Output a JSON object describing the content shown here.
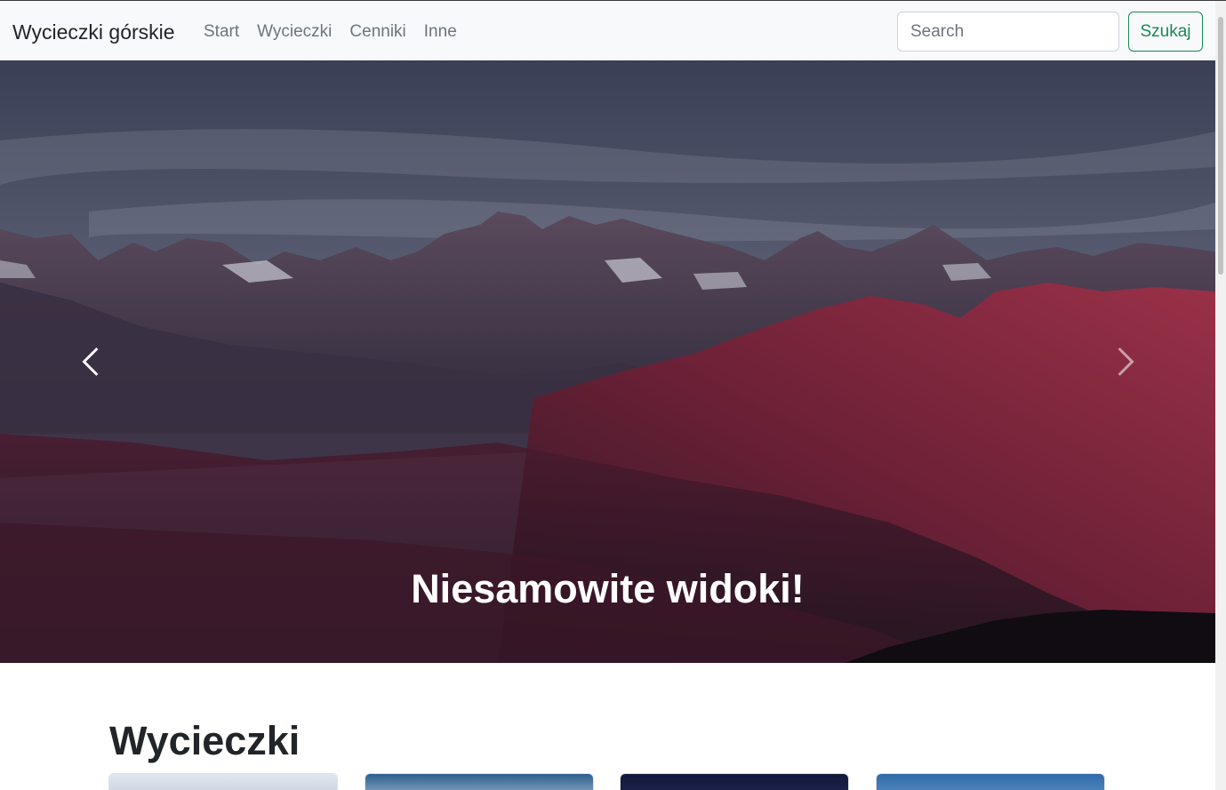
{
  "navbar": {
    "brand": "Wycieczki górskie",
    "links": [
      "Start",
      "Wycieczki",
      "Cenniki",
      "Inne"
    ],
    "search": {
      "placeholder": "Search",
      "value": ""
    },
    "search_button": "Szukaj"
  },
  "carousel": {
    "caption": "Niesamowite widoki!",
    "prev_icon": "chevron-left-icon",
    "next_icon": "chevron-right-icon"
  },
  "section": {
    "title": "Wycieczki"
  },
  "colors": {
    "success": "#198754",
    "navbar_bg": "#f8f9fa",
    "muted": "#6c757d"
  }
}
